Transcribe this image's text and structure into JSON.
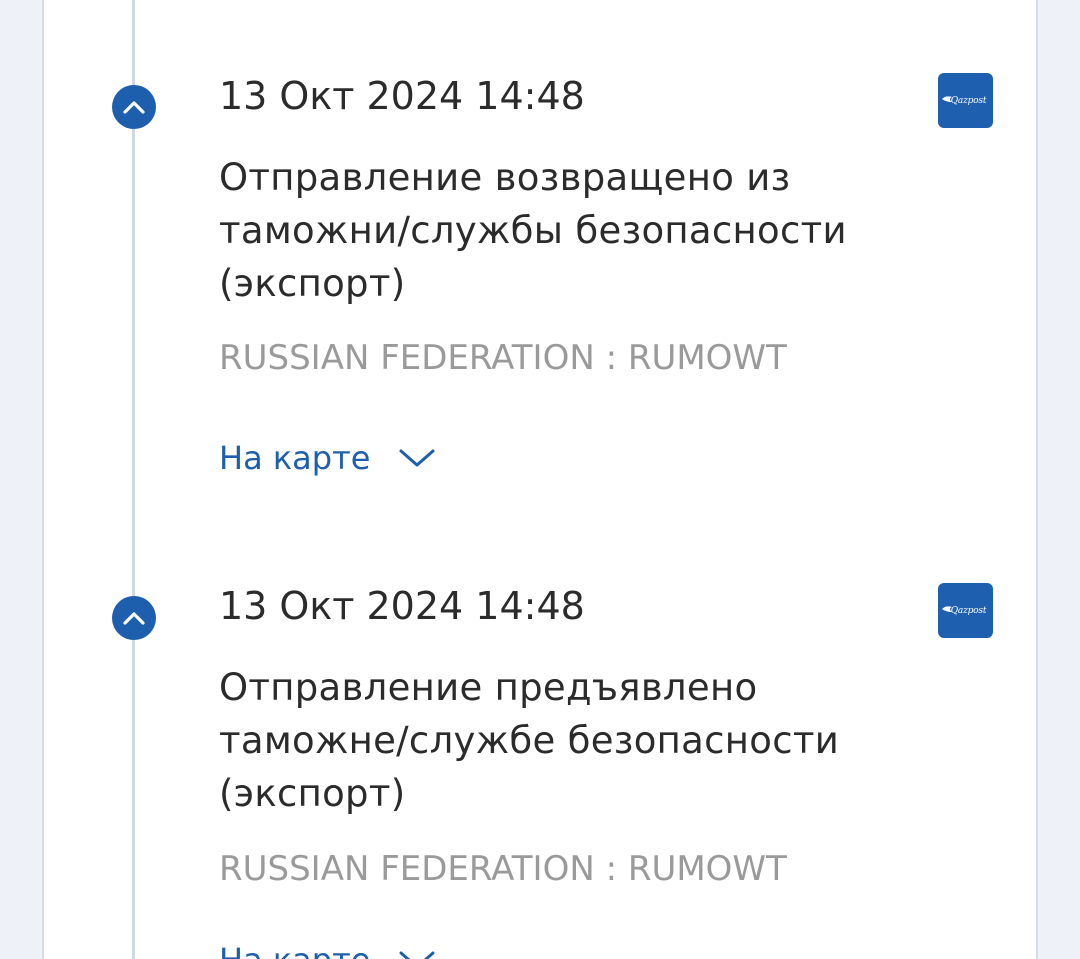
{
  "events": [
    {
      "date": "13 Окт 2024 14:48",
      "description_lines": [
        "Отправление возвращено из",
        "таможни/службы безопасности",
        "(экспорт)"
      ],
      "location": "RUSSIAN FEDERATION : RUMOWT",
      "map_link_label": "На карте",
      "carrier_logo_text": "Qazpost"
    },
    {
      "date": "13 Окт 2024 14:48",
      "description_lines": [
        "Отправление предъявлено",
        "таможне/службе безопасности",
        "(экспорт)"
      ],
      "location": "RUSSIAN FEDERATION : RUMOWT",
      "map_link_label": "На карте",
      "carrier_logo_text": "Qazpost"
    }
  ],
  "icons": {
    "node": "chevron-up-icon",
    "expand": "chevron-down-icon"
  },
  "colors": {
    "accent": "#1e5fad",
    "text": "#2b2b2b",
    "muted": "#9a9a9a",
    "background": "#eef2f8",
    "timeline": "#cfd8e6"
  }
}
